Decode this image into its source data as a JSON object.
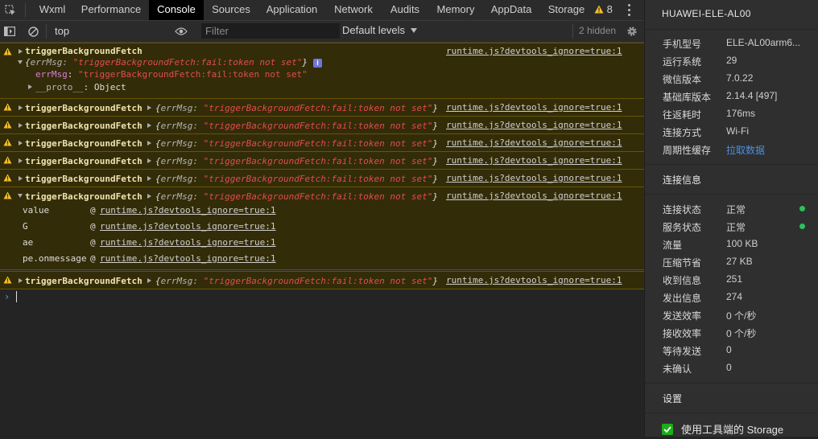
{
  "tabs": [
    "Wxml",
    "Performance",
    "Console",
    "Sources",
    "Application",
    "Network",
    "Audits",
    "Memory",
    "AppData",
    "Storage"
  ],
  "active_tab": "Console",
  "warning_count": "8",
  "toolbar": {
    "context": "top",
    "filter_placeholder": "Filter",
    "levels": "Default levels",
    "hidden": "2 hidden"
  },
  "console": {
    "fn": "triggerBackgroundFetch",
    "source": "runtime.js?devtools_ignore=true:1",
    "obj_open": "{",
    "obj_key": "errMsg: ",
    "obj_val": "\"triggerBackgroundFetch:fail:token not set\"",
    "obj_close": "}",
    "expanded_key": "errMsg",
    "expanded_val": "\"triggerBackgroundFetch:fail:token not set\"",
    "proto_key": "__proto__",
    "proto_val": "Object",
    "info_glyph": "i",
    "stack": [
      {
        "fn": "value",
        "at": "@",
        "src": "runtime.js?devtools_ignore=true:1"
      },
      {
        "fn": "G",
        "at": "@",
        "src": "runtime.js?devtools_ignore=true:1"
      },
      {
        "fn": "ae",
        "at": "@",
        "src": "runtime.js?devtools_ignore=true:1"
      },
      {
        "fn": "pe.onmessage",
        "at": "@",
        "src": "runtime.js?devtools_ignore=true:1"
      }
    ],
    "prompt": "›"
  },
  "panel": {
    "device": "HUAWEI-ELE-AL00",
    "info": [
      {
        "label": "手机型号",
        "value": "ELE-AL00arm6..."
      },
      {
        "label": "运行系统",
        "value": "29"
      },
      {
        "label": "微信版本",
        "value": "7.0.22"
      },
      {
        "label": "基础库版本",
        "value": "2.14.4 [497]"
      },
      {
        "label": "往返耗时",
        "value": "176ms"
      },
      {
        "label": "连接方式",
        "value": "Wi-Fi"
      },
      {
        "label": "周期性缓存",
        "value": "拉取数据"
      }
    ],
    "conn_title": "连接信息",
    "conn": [
      {
        "label": "连接状态",
        "value": "正常"
      },
      {
        "label": "服务状态",
        "value": "正常"
      },
      {
        "label": "流量",
        "value": "100 KB"
      },
      {
        "label": "压缩节省",
        "value": "27 KB"
      },
      {
        "label": "收到信息",
        "value": "251"
      },
      {
        "label": "发出信息",
        "value": "274"
      },
      {
        "label": "发送效率",
        "value": "0 个/秒"
      },
      {
        "label": "接收效率",
        "value": "0 个/秒"
      },
      {
        "label": "等待发送",
        "value": "0"
      },
      {
        "label": "未确认",
        "value": "0"
      }
    ],
    "settings_title": "设置",
    "storage_label": "使用工具端的 Storage"
  },
  "colors": {
    "accent": "#4a90e2",
    "warning_bg": "#332c08",
    "status_ok": "#2fbf59",
    "error_string": "#e14c4c"
  }
}
